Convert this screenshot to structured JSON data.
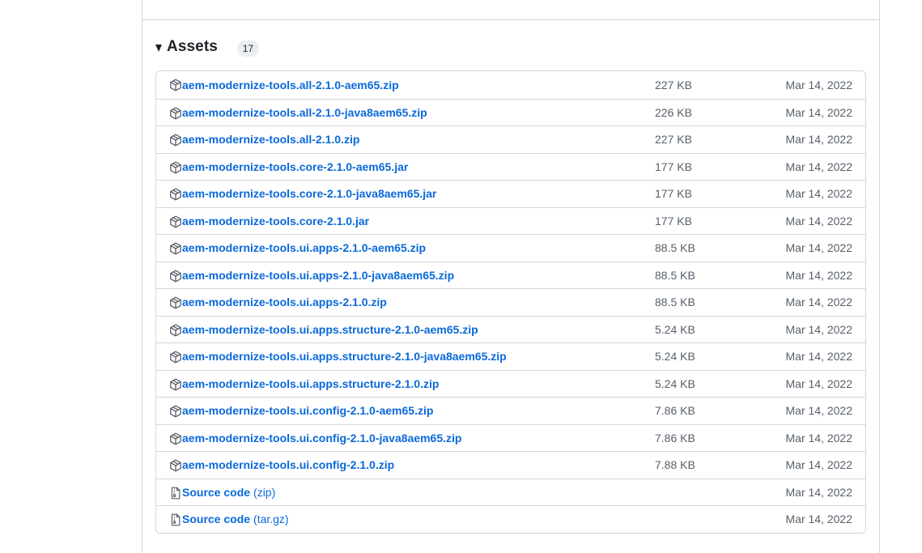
{
  "assets": {
    "title": "Assets",
    "count": "17",
    "items": [
      {
        "name": "aem-modernize-tools.all-2.1.0-aem65.zip",
        "size": "227 KB",
        "date": "Mar 14, 2022",
        "icon": "package-icon"
      },
      {
        "name": "aem-modernize-tools.all-2.1.0-java8aem65.zip",
        "size": "226 KB",
        "date": "Mar 14, 2022",
        "icon": "package-icon"
      },
      {
        "name": "aem-modernize-tools.all-2.1.0.zip",
        "size": "227 KB",
        "date": "Mar 14, 2022",
        "icon": "package-icon"
      },
      {
        "name": "aem-modernize-tools.core-2.1.0-aem65.jar",
        "size": "177 KB",
        "date": "Mar 14, 2022",
        "icon": "package-icon"
      },
      {
        "name": "aem-modernize-tools.core-2.1.0-java8aem65.jar",
        "size": "177 KB",
        "date": "Mar 14, 2022",
        "icon": "package-icon"
      },
      {
        "name": "aem-modernize-tools.core-2.1.0.jar",
        "size": "177 KB",
        "date": "Mar 14, 2022",
        "icon": "package-icon"
      },
      {
        "name": "aem-modernize-tools.ui.apps-2.1.0-aem65.zip",
        "size": "88.5 KB",
        "date": "Mar 14, 2022",
        "icon": "package-icon"
      },
      {
        "name": "aem-modernize-tools.ui.apps-2.1.0-java8aem65.zip",
        "size": "88.5 KB",
        "date": "Mar 14, 2022",
        "icon": "package-icon"
      },
      {
        "name": "aem-modernize-tools.ui.apps-2.1.0.zip",
        "size": "88.5 KB",
        "date": "Mar 14, 2022",
        "icon": "package-icon"
      },
      {
        "name": "aem-modernize-tools.ui.apps.structure-2.1.0-aem65.zip",
        "size": "5.24 KB",
        "date": "Mar 14, 2022",
        "icon": "package-icon"
      },
      {
        "name": "aem-modernize-tools.ui.apps.structure-2.1.0-java8aem65.zip",
        "size": "5.24 KB",
        "date": "Mar 14, 2022",
        "icon": "package-icon"
      },
      {
        "name": "aem-modernize-tools.ui.apps.structure-2.1.0.zip",
        "size": "5.24 KB",
        "date": "Mar 14, 2022",
        "icon": "package-icon"
      },
      {
        "name": "aem-modernize-tools.ui.config-2.1.0-aem65.zip",
        "size": "7.86 KB",
        "date": "Mar 14, 2022",
        "icon": "package-icon"
      },
      {
        "name": "aem-modernize-tools.ui.config-2.1.0-java8aem65.zip",
        "size": "7.86 KB",
        "date": "Mar 14, 2022",
        "icon": "package-icon"
      },
      {
        "name": "aem-modernize-tools.ui.config-2.1.0.zip",
        "size": "7.88 KB",
        "date": "Mar 14, 2022",
        "icon": "package-icon"
      },
      {
        "name": "Source code",
        "suffix": "(zip)",
        "size": "",
        "date": "Mar 14, 2022",
        "icon": "file-zip-icon"
      },
      {
        "name": "Source code",
        "suffix": "(tar.gz)",
        "size": "",
        "date": "Mar 14, 2022",
        "icon": "file-zip-icon"
      }
    ]
  },
  "colors": {
    "link": "#0969da",
    "muted": "#57606a",
    "border": "#d0d7de",
    "counter_bg": "#eaeef2"
  }
}
